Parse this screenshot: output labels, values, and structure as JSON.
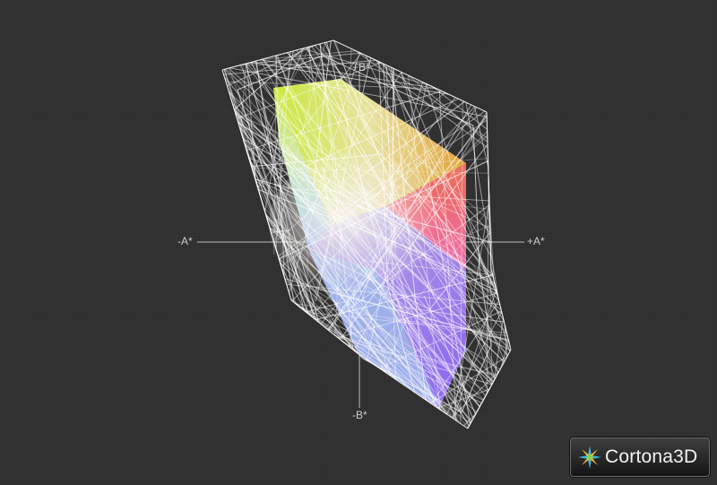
{
  "axes": {
    "plus_a": "+A*",
    "minus_a": "-A*",
    "plus_b": "+B*",
    "minus_b": "-B*"
  },
  "badge": {
    "brand": "Cortona3D",
    "icon": "cortona-star-icon"
  },
  "colors": {
    "background": "#2f2f2f",
    "axis_line": "#bdbdbd",
    "wireframe": "#ffffff",
    "badge_accent": "#3fb8e0"
  }
}
